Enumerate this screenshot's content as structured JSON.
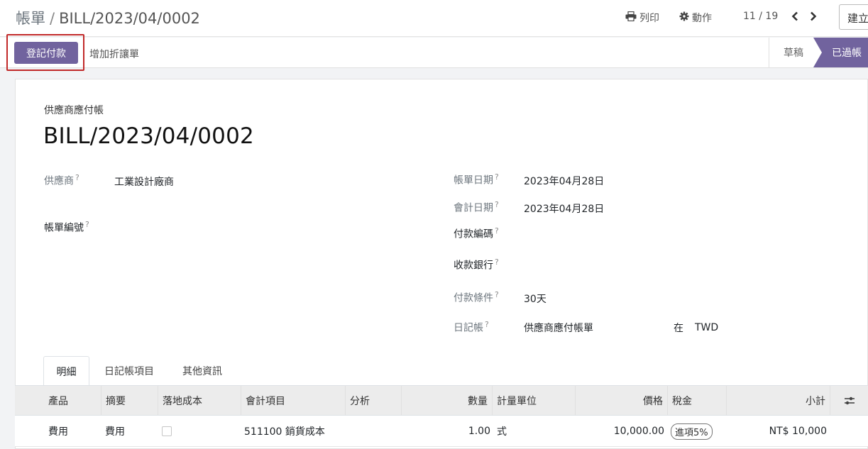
{
  "breadcrumb": {
    "root": "帳單",
    "separator": "/",
    "current": "BILL/2023/04/0002"
  },
  "toolbar": {
    "print_label": "列印",
    "print_icon": "print-icon",
    "action_label": "動作",
    "action_icon": "gear-icon",
    "pager": "11 / 19",
    "create_label": "建立"
  },
  "statusbar": {
    "register_payment_label": "登記付款",
    "add_credit_note_label": "增加折讓單",
    "stages": [
      {
        "label": "草稿",
        "active": false
      },
      {
        "label": "已過帳",
        "active": true
      }
    ],
    "accent": "#71639e",
    "highlight_color": "#c12929"
  },
  "form": {
    "doc_type": "供應商應付帳",
    "doc_number": "BILL/2023/04/0002",
    "fields": {
      "vendor": {
        "label": "供應商",
        "value": "工業設計廠商"
      },
      "bill_ref": {
        "label": "帳單編號",
        "value": ""
      },
      "bill_date": {
        "label": "帳單日期",
        "value": "2023年04月28日"
      },
      "acc_date": {
        "label": "會計日期",
        "value": "2023年04月28日"
      },
      "payment_ref": {
        "label": "付款編碼",
        "value": ""
      },
      "bank": {
        "label": "收款銀行",
        "value": ""
      },
      "terms": {
        "label": "付款條件",
        "value": "30天"
      },
      "journal": {
        "label": "日記帳",
        "value": "供應商應付帳單",
        "in_label": "在",
        "currency": "TWD"
      }
    },
    "help_mark": "?"
  },
  "tabs": [
    {
      "label": "明細",
      "active": true
    },
    {
      "label": "日記帳項目",
      "active": false
    },
    {
      "label": "其他資訊",
      "active": false
    }
  ],
  "table": {
    "headers": {
      "product": "產品",
      "label": "摘要",
      "landed": "落地成本",
      "account": "會計項目",
      "analytic": "分析",
      "qty": "數量",
      "uom": "計量單位",
      "price": "價格",
      "taxes": "稅金",
      "subtotal": "小計"
    },
    "rows": [
      {
        "product": "費用",
        "label": "費用",
        "landed": false,
        "account": "511100 銷貨成本",
        "analytic": "",
        "qty": "1.00",
        "uom": "式",
        "price": "10,000.00",
        "taxes": "進項5%",
        "subtotal": "NT$ 10,000"
      }
    ]
  }
}
